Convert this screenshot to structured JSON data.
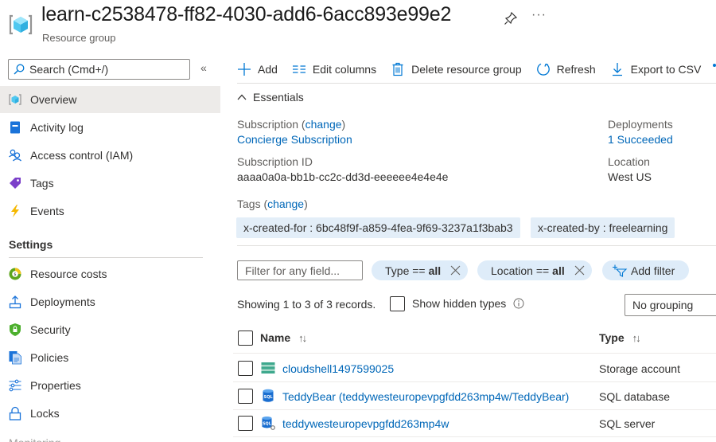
{
  "header": {
    "title": "learn-c2538478-ff82-4030-add6-6acc893e99e2",
    "subtitle": "Resource group",
    "icon": "resource-group-icon",
    "pin_icon": "pin-icon",
    "more_label": "···"
  },
  "sidebar": {
    "search_placeholder": "Search (Cmd+/)",
    "collapse_label": "«",
    "items": [
      {
        "label": "Overview",
        "icon": "resource-group-icon",
        "active": true
      },
      {
        "label": "Activity log",
        "icon": "activity-log-icon"
      },
      {
        "label": "Access control (IAM)",
        "icon": "people-icon"
      },
      {
        "label": "Tags",
        "icon": "tag-icon"
      },
      {
        "label": "Events",
        "icon": "lightning-icon"
      }
    ],
    "settings_title": "Settings",
    "settings_items": [
      {
        "label": "Resource costs",
        "icon": "cost-icon"
      },
      {
        "label": "Deployments",
        "icon": "upload-icon"
      },
      {
        "label": "Security",
        "icon": "shield-icon"
      },
      {
        "label": "Policies",
        "icon": "policy-icon"
      },
      {
        "label": "Properties",
        "icon": "sliders-icon"
      },
      {
        "label": "Locks",
        "icon": "lock-icon"
      }
    ],
    "next_section_partial": "Monitoring"
  },
  "toolbar": {
    "add": "Add",
    "edit_columns": "Edit columns",
    "delete": "Delete resource group",
    "refresh": "Refresh",
    "export": "Export to CSV"
  },
  "essentials": {
    "toggle_label": "Essentials",
    "subscription_label": "Subscription",
    "change_link": "change",
    "subscription_value": "Concierge Subscription",
    "subscription_id_label": "Subscription ID",
    "subscription_id_value": "aaaa0a0a-bb1b-cc2c-dd3d-eeeeee4e4e4e",
    "deployments_label": "Deployments",
    "deployments_value": "1 Succeeded",
    "location_label": "Location",
    "location_value": "West US",
    "tags_label": "Tags",
    "tags": [
      "x-created-for : 6bc48f9f-a859-4fea-9f69-3237a1f3bab3",
      "x-created-by : freelearning"
    ]
  },
  "filters": {
    "filter_placeholder": "Filter for any field...",
    "type_pill_prefix": "Type ==",
    "type_pill_value": "all",
    "location_pill_prefix": "Location ==",
    "location_pill_value": "all",
    "add_filter": "Add filter",
    "records_text": "Showing 1 to 3 of 3 records.",
    "show_hidden_label": "Show hidden types",
    "show_hidden_checked": false,
    "grouping_value": "No grouping"
  },
  "table": {
    "columns": [
      {
        "label": "Name",
        "sort": "↑↓"
      },
      {
        "label": "Type",
        "sort": "↑↓"
      }
    ],
    "rows": [
      {
        "name": "cloudshell1497599025",
        "type": "Storage account",
        "icon": "storage-account-icon"
      },
      {
        "name": "TeddyBear (teddywesteuropevpgfdd263mp4w/TeddyBear)",
        "type": "SQL database",
        "icon": "sql-database-icon"
      },
      {
        "name": "teddywesteuropevpgfdd263mp4w",
        "type": "SQL server",
        "icon": "sql-server-icon"
      }
    ]
  },
  "colors": {
    "link": "#0067b8",
    "accent": "#0078d4",
    "pill_bg": "#deecf9",
    "tag_bg": "#e3eef8",
    "active_nav_bg": "#edebe9"
  }
}
